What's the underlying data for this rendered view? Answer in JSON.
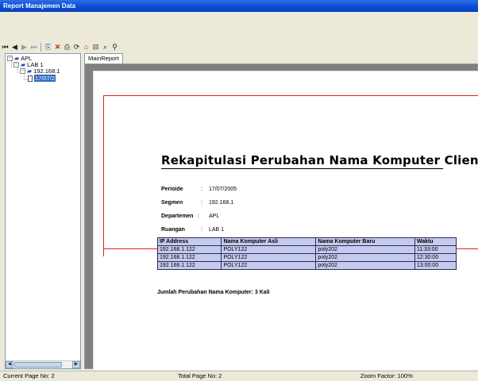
{
  "window": {
    "title": "Report Manajemen Data"
  },
  "toolbar": {
    "buttons": [
      {
        "name": "first-page-icon",
        "glyph": "⏮"
      },
      {
        "name": "previous-page-icon",
        "glyph": "◀"
      },
      {
        "name": "next-page-icon",
        "glyph": "▶"
      },
      {
        "name": "last-page-icon",
        "glyph": "⏭"
      },
      {
        "name": "export-icon",
        "glyph": "⎘"
      },
      {
        "name": "close-icon",
        "glyph": "✕"
      },
      {
        "name": "print-icon",
        "glyph": "⎙"
      },
      {
        "name": "refresh-icon",
        "glyph": "⟳"
      },
      {
        "name": "group-tree-icon",
        "glyph": "⌂"
      },
      {
        "name": "toggle-tree-icon",
        "glyph": "⊟"
      },
      {
        "name": "zoom-icon",
        "glyph": "⌕"
      },
      {
        "name": "search-icon",
        "glyph": "⚲"
      }
    ]
  },
  "tree": {
    "root": "APL",
    "child": "LAB 1",
    "grandchild": "192.168.1",
    "leaf": "17/07/2"
  },
  "tab": {
    "label": "MainReport"
  },
  "report": {
    "title": "Rekapitulasi Perubahan Nama Komputer Client",
    "meta": [
      {
        "label": "Perioide",
        "value": "17/07/2005"
      },
      {
        "label": "Segmen",
        "value": "192.168.1"
      },
      {
        "label": "Departemen",
        "value": "APL"
      },
      {
        "label": "Ruangan",
        "value": "LAB 1"
      }
    ],
    "table": {
      "headers": [
        "IP Address",
        "Nama Komputer Asli",
        "Nama Komputer Baru",
        "Waktu"
      ],
      "rows": [
        [
          "192.168.1.122",
          "POLY122",
          "poly202",
          "11:33:00"
        ],
        [
          "192.168.1.122",
          "POLY122",
          "poly202",
          "12:30:00"
        ],
        [
          "192.168.1.122",
          "POLY122",
          "poly202",
          "13:00:00"
        ]
      ]
    },
    "summary": "Jumlah Perubahan Nama Komputer:  3  Kali"
  },
  "status": {
    "current_page": "Current Page No: 2",
    "total_page": "Total Page No: 2",
    "zoom": "Zoom Factor: 100%"
  }
}
